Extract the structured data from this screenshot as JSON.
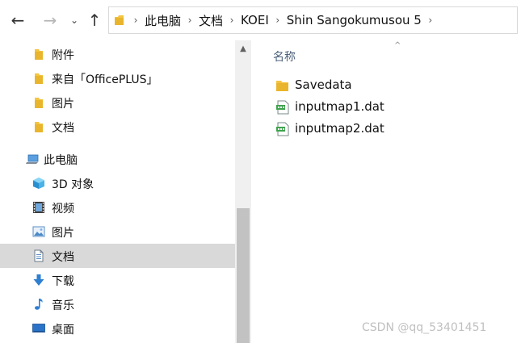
{
  "navigation": {
    "back_glyph": "←",
    "forward_glyph": "→",
    "recent_glyph": "⌄",
    "up_glyph": "↑"
  },
  "breadcrumb": {
    "separator": "›",
    "items": [
      "此电脑",
      "文档",
      "KOEI",
      "Shin Sangokumusou 5"
    ]
  },
  "sidebar": {
    "quick_access": [
      {
        "label": "附件",
        "icon": "folder-icon"
      },
      {
        "label": "来自「OfficePLUS」",
        "icon": "folder-icon"
      },
      {
        "label": "图片",
        "icon": "folder-icon"
      },
      {
        "label": "文档",
        "icon": "folder-icon"
      }
    ],
    "this_pc": {
      "label": "此电脑",
      "icon": "computer-icon"
    },
    "pc_items": [
      {
        "label": "3D 对象",
        "icon": "3d-objects-icon"
      },
      {
        "label": "视频",
        "icon": "video-icon"
      },
      {
        "label": "图片",
        "icon": "pictures-icon"
      },
      {
        "label": "文档",
        "icon": "documents-icon",
        "selected": true
      },
      {
        "label": "下载",
        "icon": "download-icon"
      },
      {
        "label": "音乐",
        "icon": "music-icon"
      },
      {
        "label": "桌面",
        "icon": "desktop-icon"
      }
    ]
  },
  "content": {
    "column_header": "名称",
    "sort_glyph": "^",
    "files": [
      {
        "name": "Savedata",
        "icon": "folder-icon"
      },
      {
        "name": "inputmap1.dat",
        "icon": "dat-file-icon"
      },
      {
        "name": "inputmap2.dat",
        "icon": "dat-file-icon"
      }
    ]
  },
  "scrollbar": {
    "up_glyph": "▲"
  },
  "watermark": "CSDN @qq_53401451",
  "colors": {
    "folder_yellow": "#f4c542",
    "selection": "#d9d9d9",
    "header_text": "#4c607a",
    "scroll_track": "#f0f0f0",
    "scroll_thumb": "#c2c2c2"
  }
}
